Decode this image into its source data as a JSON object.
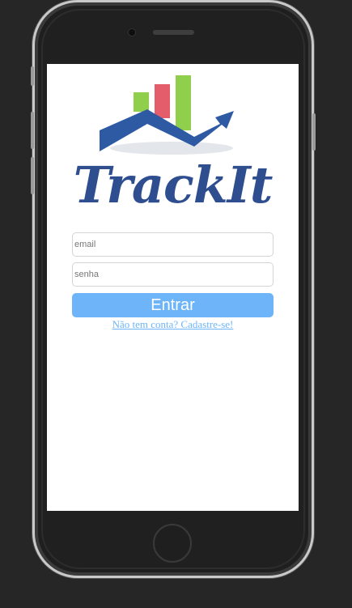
{
  "app": {
    "name": "TrackIt"
  },
  "login": {
    "email_placeholder": "email",
    "password_placeholder": "senha",
    "submit_label": "Entrar",
    "signup_link": "Não tem conta? Cadastre-se!"
  },
  "colors": {
    "brand_blue": "#2e4e8f",
    "accent_blue": "#6db5f8",
    "bar_green": "#8fcf4c",
    "bar_red": "#e35d6a"
  },
  "icons": {
    "logo": "chart-trend-logo-icon"
  }
}
